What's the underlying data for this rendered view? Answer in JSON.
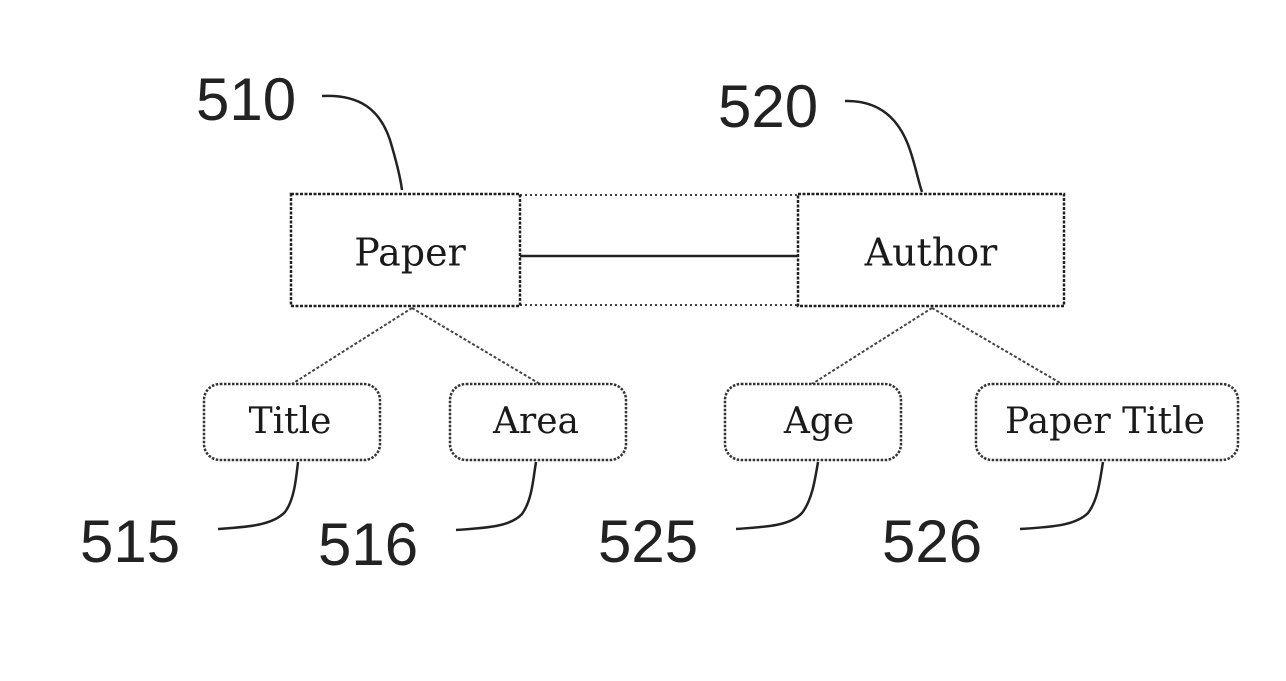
{
  "diagram": {
    "entities": [
      {
        "id": "paper",
        "label": "Paper",
        "ref": "510"
      },
      {
        "id": "author",
        "label": "Author",
        "ref": "520"
      }
    ],
    "attributes": [
      {
        "parent": "paper",
        "label": "Title",
        "ref": "515"
      },
      {
        "parent": "paper",
        "label": "Area",
        "ref": "516"
      },
      {
        "parent": "author",
        "label": "Age",
        "ref": "525"
      },
      {
        "parent": "author",
        "label": "Paper Title",
        "ref": "526"
      }
    ],
    "relationship": {
      "from": "paper",
      "to": "author"
    }
  }
}
